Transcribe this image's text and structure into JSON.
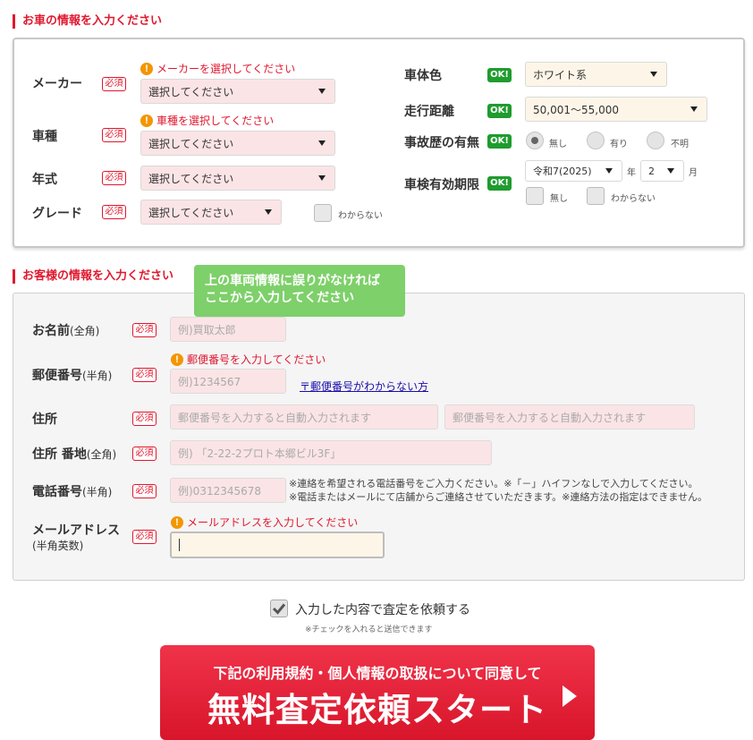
{
  "car_section": {
    "title": "お車の情報を入力ください",
    "required_label": "必須",
    "ok_label": "OK!",
    "maker": {
      "label": "メーカー",
      "error": "メーカーを選択してください",
      "value": "選択してください"
    },
    "model": {
      "label": "車種",
      "error": "車種を選択してください",
      "value": "選択してください"
    },
    "year": {
      "label": "年式",
      "value": "選択してください"
    },
    "grade": {
      "label": "グレード",
      "value": "選択してください",
      "unknown_label": "わからない"
    },
    "color": {
      "label": "車体色",
      "value": "ホワイト系"
    },
    "mileage": {
      "label": "走行距離",
      "value": "50,001～55,000"
    },
    "accident": {
      "label": "事故歴の有無",
      "options": [
        "無し",
        "有り",
        "不明"
      ],
      "selected": "無し"
    },
    "inspection": {
      "label": "車検有効期限",
      "year_value": "令和7(2025)",
      "year_unit": "年",
      "month_value": "2",
      "month_unit": "月",
      "none_label": "無し",
      "unknown_label": "わからない"
    }
  },
  "customer_section": {
    "title": "お客様の情報を入力ください",
    "tooltip": [
      "上の車両情報に誤りがなければ",
      "ここから入力してください"
    ],
    "required_label": "必須",
    "name": {
      "label": "お名前",
      "suffix": "(全角)",
      "placeholder": "例)買取太郎"
    },
    "zip": {
      "label": "郵便番号",
      "suffix": "(半角)",
      "error": "郵便番号を入力してください",
      "placeholder": "例)1234567",
      "help_link": "〒郵便番号がわからない方"
    },
    "address": {
      "label": "住所",
      "placeholder1": "郵便番号を入力すると自動入力されます",
      "placeholder2": "郵便番号を入力すると自動入力されます"
    },
    "address_detail": {
      "label": "住所 番地",
      "suffix": "(全角)",
      "placeholder": "例) 「2-22-2プロト本郷ビル3F」"
    },
    "phone": {
      "label": "電話番号",
      "suffix": "(半角)",
      "placeholder": "例)0312345678",
      "note1": "※連絡を希望される電話番号をご入力ください。※「－」ハイフンなしで入力してください。",
      "note2": "※電話またはメールにて店舗からご連絡させていただきます。※連絡方法の指定はできません。"
    },
    "email": {
      "label": "メールアドレス",
      "suffix": "(半角英数)",
      "error": "メールアドレスを入力してください",
      "value": ""
    }
  },
  "consent": {
    "label": "入力した内容で査定を依頼する",
    "note": "※チェックを入れると送信できます",
    "checked": true
  },
  "submit": {
    "line1": "下記の利用規約・個人情報の取扱について同意して",
    "line2": "無料査定依頼スタート"
  },
  "colors": {
    "accent": "#e0182e",
    "ok_green": "#1f9c2e",
    "tooltip_green": "#7ed06a"
  }
}
